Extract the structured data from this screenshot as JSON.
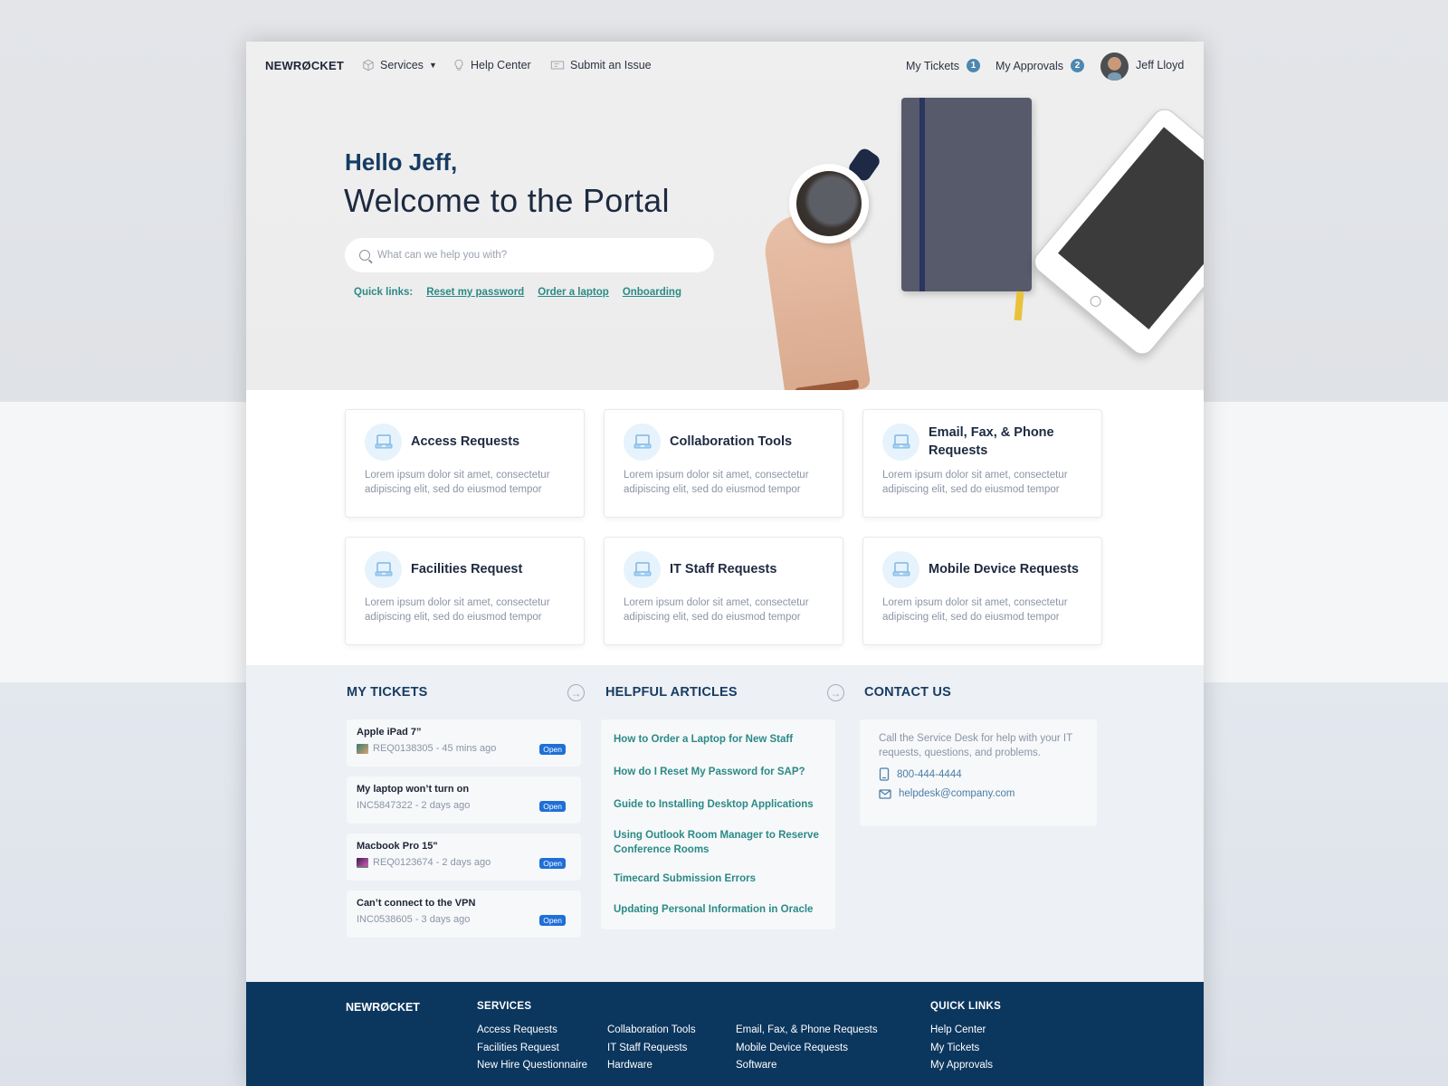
{
  "nav": {
    "logo": "NEWRØCKET",
    "services": "Services",
    "help_center": "Help Center",
    "submit_issue": "Submit an Issue",
    "my_tickets": "My Tickets",
    "my_tickets_count": "1",
    "my_approvals": "My Approvals",
    "my_approvals_count": "2",
    "user_name": "Jeff Lloyd"
  },
  "hero": {
    "greeting": "Hello Jeff,",
    "welcome": "Welcome to the Portal",
    "search_placeholder": "What can we help you with?",
    "quick_links_label": "Quick links:",
    "quick_links": [
      "Reset my password",
      "Order a laptop",
      "Onboarding"
    ]
  },
  "services": [
    {
      "title": "Access Requests",
      "desc": "Lorem ipsum dolor sit amet, consectetur adipiscing elit, sed do eiusmod tempor"
    },
    {
      "title": "Collaboration Tools",
      "desc": "Lorem ipsum dolor sit amet, consectetur adipiscing elit, sed do eiusmod tempor"
    },
    {
      "title": "Email, Fax, & Phone Requests",
      "desc": "Lorem ipsum dolor sit amet, consectetur adipiscing elit, sed do eiusmod tempor"
    },
    {
      "title": "Facilities Request",
      "desc": "Lorem ipsum dolor sit amet, consectetur adipiscing elit, sed do eiusmod tempor"
    },
    {
      "title": "IT Staff Requests",
      "desc": "Lorem ipsum dolor sit amet, consectetur adipiscing elit, sed do eiusmod tempor"
    },
    {
      "title": "Mobile Device Requests",
      "desc": "Lorem ipsum dolor sit amet, consectetur adipiscing elit, sed do eiusmod tempor"
    }
  ],
  "my_tickets": {
    "title": "MY TICKETS",
    "items": [
      {
        "title": "Apple iPad 7”",
        "meta": "REQ0138305 - 45 mins ago",
        "status": "Open",
        "thumb": "ipad"
      },
      {
        "title": "My laptop won’t turn on",
        "meta": "INC5847322 - 2 days ago",
        "status": "Open",
        "thumb": ""
      },
      {
        "title": "Macbook Pro 15\"",
        "meta": "REQ0123674 - 2 days ago",
        "status": "Open",
        "thumb": "mac"
      },
      {
        "title": "Can’t connect to the VPN",
        "meta": "INC0538605 - 3 days ago",
        "status": "Open",
        "thumb": ""
      }
    ]
  },
  "helpful_articles": {
    "title": "HELPFUL ARTICLES",
    "items": [
      "How to Order a Laptop for New Staff",
      "How do I Reset My Password for SAP?",
      "Guide to Installing Desktop Applications",
      "Using Outlook Room Manager to Reserve Conference Rooms",
      "Timecard Submission Errors",
      "Updating Personal Information in Oracle"
    ]
  },
  "contact": {
    "title": "CONTACT US",
    "desc": "Call the Service Desk for help with your IT requests, questions, and problems.",
    "phone": "800-444-4444",
    "email": "helpdesk@company.com"
  },
  "footer": {
    "logo": "NEWRØCKET",
    "services_title": "SERVICES",
    "services_col1": [
      "Access Requests",
      "Facilities Request",
      "New Hire Questionnaire"
    ],
    "services_col2": [
      "Collaboration Tools",
      "IT Staff Requests",
      "Hardware"
    ],
    "services_col3": [
      "Email, Fax, & Phone Requests",
      "Mobile Device Requests",
      "Software"
    ],
    "quick_links_title": "QUICK LINKS",
    "quick_links": [
      "Help Center",
      "My Tickets",
      "My Approvals"
    ]
  },
  "colors": {
    "brand_navy": "#173c63",
    "footer_navy": "#0b365e",
    "teal_link": "#2b8a86",
    "badge_blue": "#4c88b0",
    "status_blue": "#1f6fd6"
  }
}
